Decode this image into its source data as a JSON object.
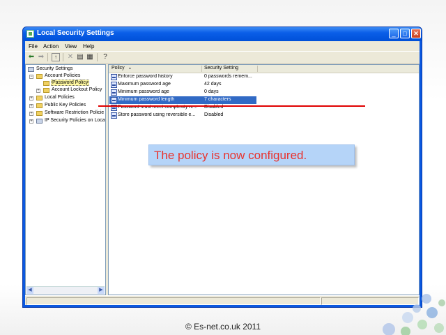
{
  "window": {
    "title": "Local Security Settings",
    "controls": {
      "minimize": "_",
      "maximize": "□",
      "close": "✕"
    }
  },
  "menu": [
    "File",
    "Action",
    "View",
    "Help"
  ],
  "toolbar": {
    "icons": [
      "back-arrow-icon",
      "forward-arrow-icon",
      "up-folder-icon",
      "delete-icon",
      "properties-icon",
      "export-icon",
      "help-icon"
    ]
  },
  "tree": {
    "root": "Security Settings",
    "account_policies": "Account Policies",
    "password_policy": "Password Policy",
    "account_lockout": "Account Lockout Policy",
    "local_policies": "Local Policies",
    "public_key": "Public Key Policies",
    "software_restriction": "Software Restriction Policie",
    "ip_security": "IP Security Policies on Loca",
    "expand": "+",
    "collapse": "−"
  },
  "list": {
    "col_policy": "Policy",
    "sort_indicator": "▲",
    "col_setting": "Security Setting",
    "rows": [
      {
        "policy": "Enforce password history",
        "setting": "0 passwords remem..."
      },
      {
        "policy": "Maximum password age",
        "setting": "42 days"
      },
      {
        "policy": "Minimum password age",
        "setting": "0 days"
      },
      {
        "policy": "Minimum password length",
        "setting": "7 characters"
      },
      {
        "policy": "Password must meet complexity re...",
        "setting": "Disabled"
      },
      {
        "policy": "Store password using reversible e...",
        "setting": "Disabled"
      }
    ],
    "selected_index": 3
  },
  "callout": {
    "text": "The policy is now configured."
  },
  "footer": {
    "copyright": "© Es-net.co.uk 2011"
  },
  "colors": {
    "accent": "#316ac5",
    "callout_bg": "#b5d4f8",
    "callout_text": "#e8332e",
    "line": "#e00000"
  }
}
